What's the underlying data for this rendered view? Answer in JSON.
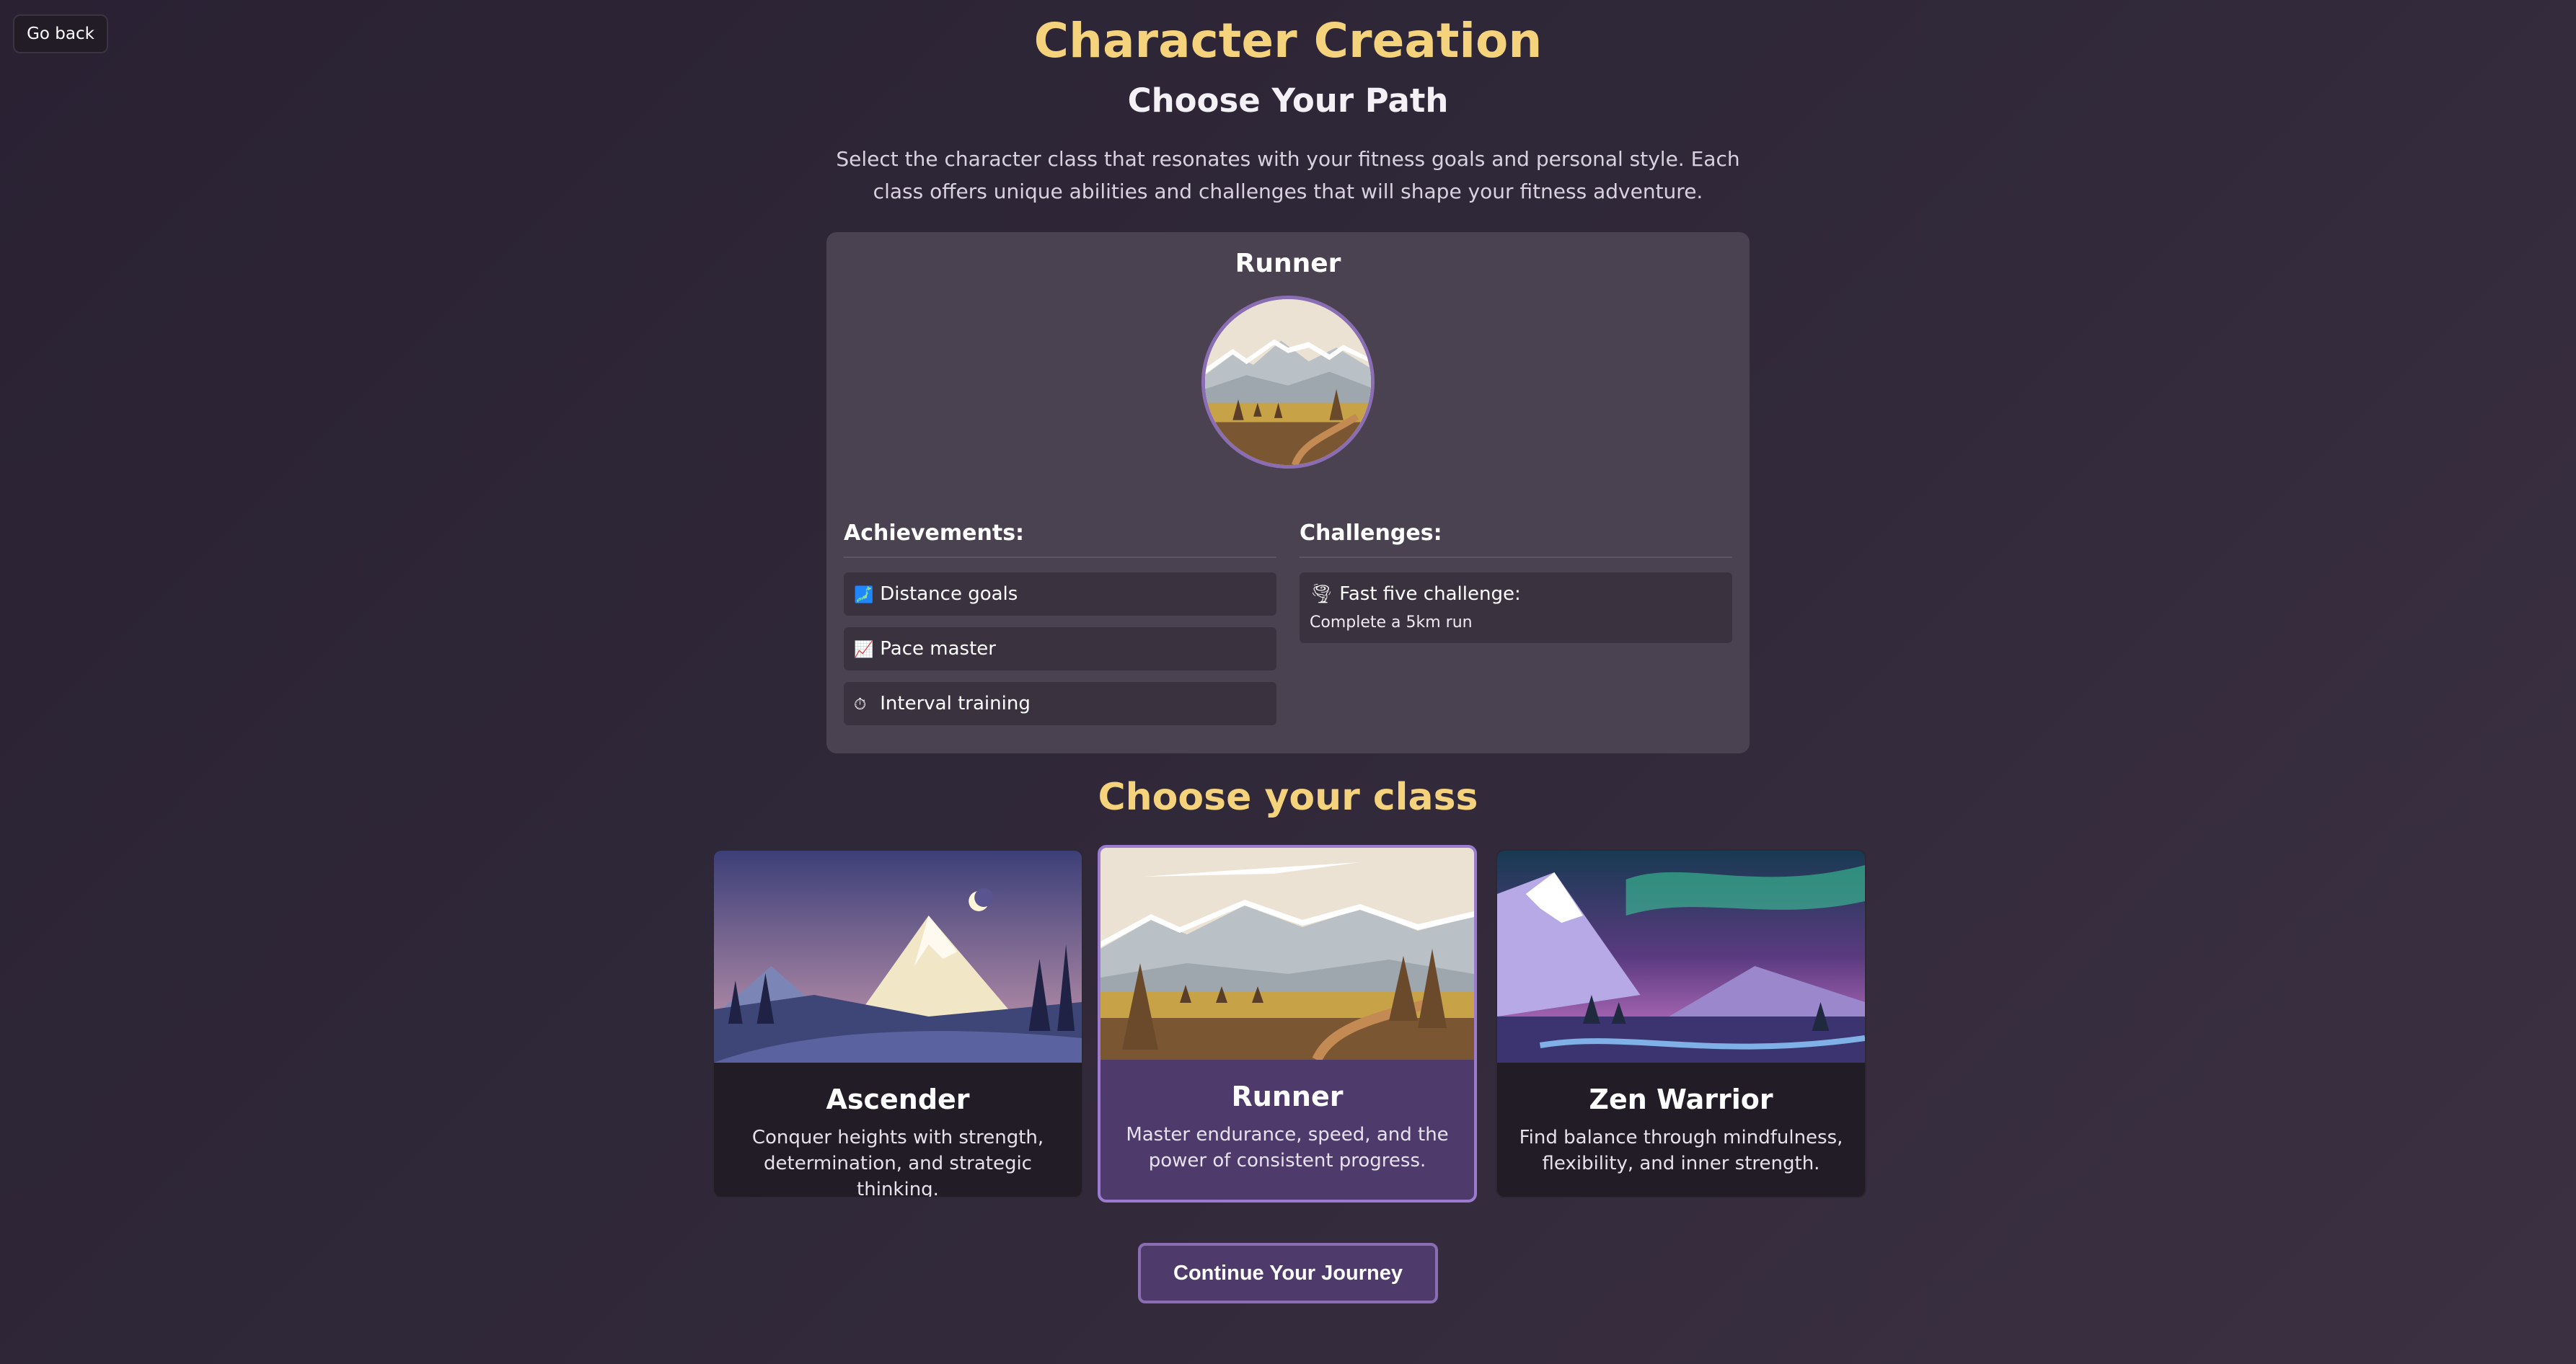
{
  "nav": {
    "back_label": "Go back"
  },
  "header": {
    "title": "Character Creation",
    "subtitle": "Choose Your Path",
    "intro": "Select the character class that resonates with your fitness goals and personal style. Each class offers unique abilities and challenges that will shape your fitness adventure."
  },
  "selected_class": {
    "name": "Runner",
    "achievements_heading": "Achievements:",
    "achievements": [
      {
        "icon": "map-icon",
        "glyph": "🗾",
        "label": "Distance goals"
      },
      {
        "icon": "chart-increasing-icon",
        "glyph": "📈",
        "label": "Pace master"
      },
      {
        "icon": "stopwatch-icon",
        "glyph": "⏱",
        "label": "Interval training"
      }
    ],
    "challenges_heading": "Challenges:",
    "challenges": [
      {
        "icon": "tornado-icon",
        "glyph": "🌪",
        "title": "Fast five challenge:",
        "description": "Complete a 5km run"
      }
    ]
  },
  "class_section": {
    "heading": "Choose your class"
  },
  "classes": [
    {
      "name": "Ascender",
      "description": "Conquer heights with strength, determination, and strategic thinking.",
      "selected": false
    },
    {
      "name": "Runner",
      "description": "Master endurance, speed, and the power of consistent progress.",
      "selected": true
    },
    {
      "name": "Zen Warrior",
      "description": "Find balance through mindfulness, flexibility, and inner strength.",
      "selected": false
    }
  ],
  "footer": {
    "continue_label": "Continue Your Journey"
  },
  "colors": {
    "accent_gold": "#f5d27c",
    "accent_purple": "#8a6db3",
    "panel": "#4a4250"
  }
}
